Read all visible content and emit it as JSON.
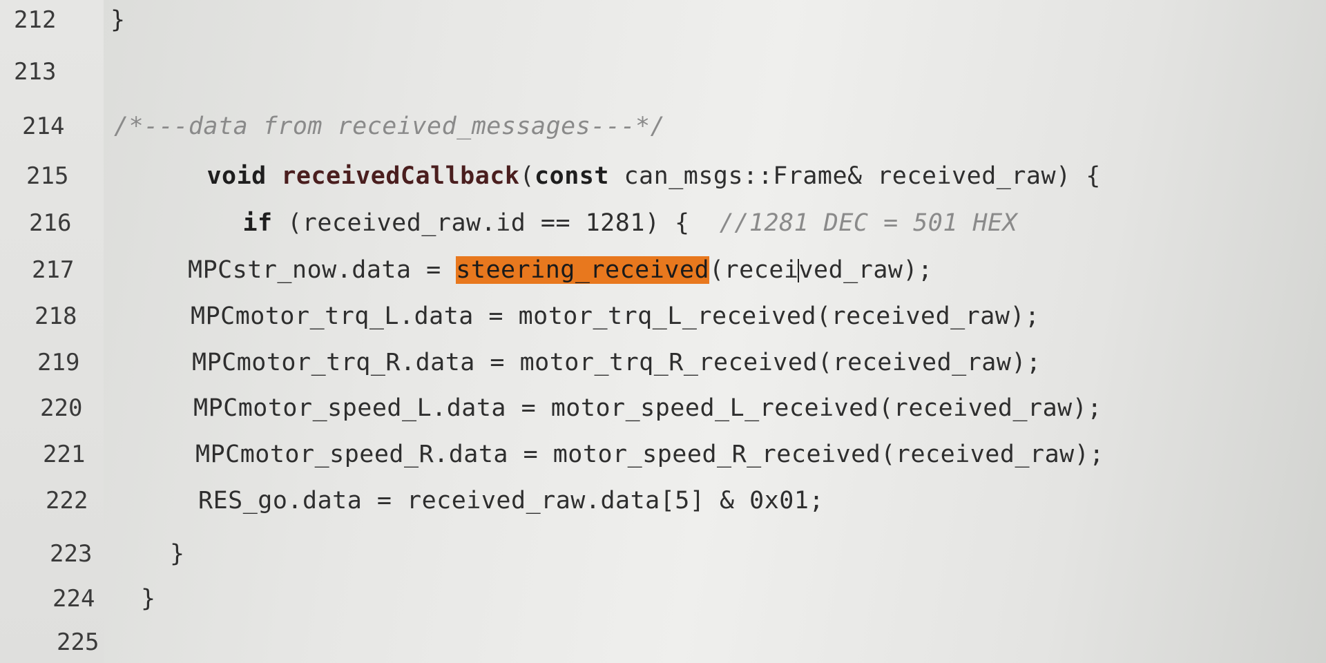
{
  "editor": {
    "lines": [
      {
        "no": "212",
        "text": "}"
      },
      {
        "no": "213",
        "text": ""
      },
      {
        "no": "214",
        "text": "/*---data from received_messages---*/"
      },
      {
        "no": "215",
        "kw1": "void",
        "fn": "receivedCallback",
        "kw2": "const",
        "rest": "can_msgs::Frame& received_raw) {"
      },
      {
        "no": "216",
        "kw": "if",
        "text": "(received_raw.id == 1281) {",
        "comment": "//1281 DEC = 501 HEX"
      },
      {
        "no": "217",
        "pre": "MPCstr_now.data = ",
        "highlight": "steering_received",
        "post_a": "(recei",
        "post_b": "ved_raw);"
      },
      {
        "no": "218",
        "text": "MPCmotor_trq_L.data = motor_trq_L_received(received_raw);"
      },
      {
        "no": "219",
        "text": "MPCmotor_trq_R.data = motor_trq_R_received(received_raw);"
      },
      {
        "no": "220",
        "text": "MPCmotor_speed_L.data = motor_speed_L_received(received_raw);"
      },
      {
        "no": "221",
        "text": "MPCmotor_speed_R.data = motor_speed_R_received(received_raw);"
      },
      {
        "no": "222",
        "text": "RES_go.data = received_raw.data[5] & 0x01;"
      },
      {
        "no": "223",
        "text": "}"
      },
      {
        "no": "224",
        "text": "}"
      },
      {
        "no": "225",
        "text": ""
      }
    ]
  }
}
